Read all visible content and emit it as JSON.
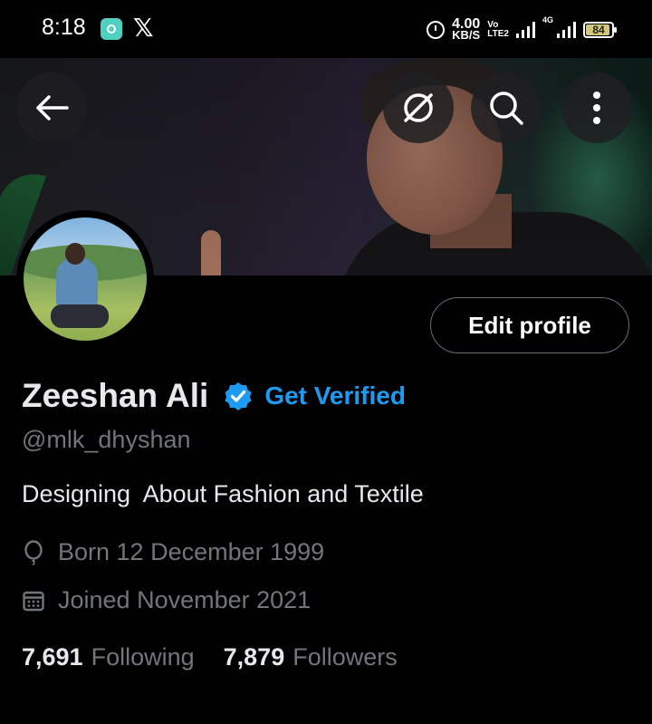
{
  "status_bar": {
    "time": "8:18",
    "net_speed_value": "4.00",
    "net_speed_unit": "KB/S",
    "volte_top": "Vo",
    "volte_bottom": "LTE2",
    "network_label": "4G",
    "battery_level": "84"
  },
  "profile": {
    "display_name": "Zeeshan Ali",
    "verified_badge_color": "#1d9bf0",
    "get_verified_label": "Get Verified",
    "handle": "@mlk_dhyshan",
    "bio": "Designing  About Fashion and Textile",
    "born": "Born 12 December 1999",
    "joined": "Joined November 2021",
    "following_count": "7,691",
    "following_label": "Following",
    "followers_count": "7,879",
    "followers_label": "Followers"
  },
  "actions": {
    "edit_profile_label": "Edit profile"
  },
  "colors": {
    "accent": "#1d9bf0",
    "background": "#000000",
    "secondary_text": "#71767b",
    "primary_text": "#e7e9ea"
  }
}
